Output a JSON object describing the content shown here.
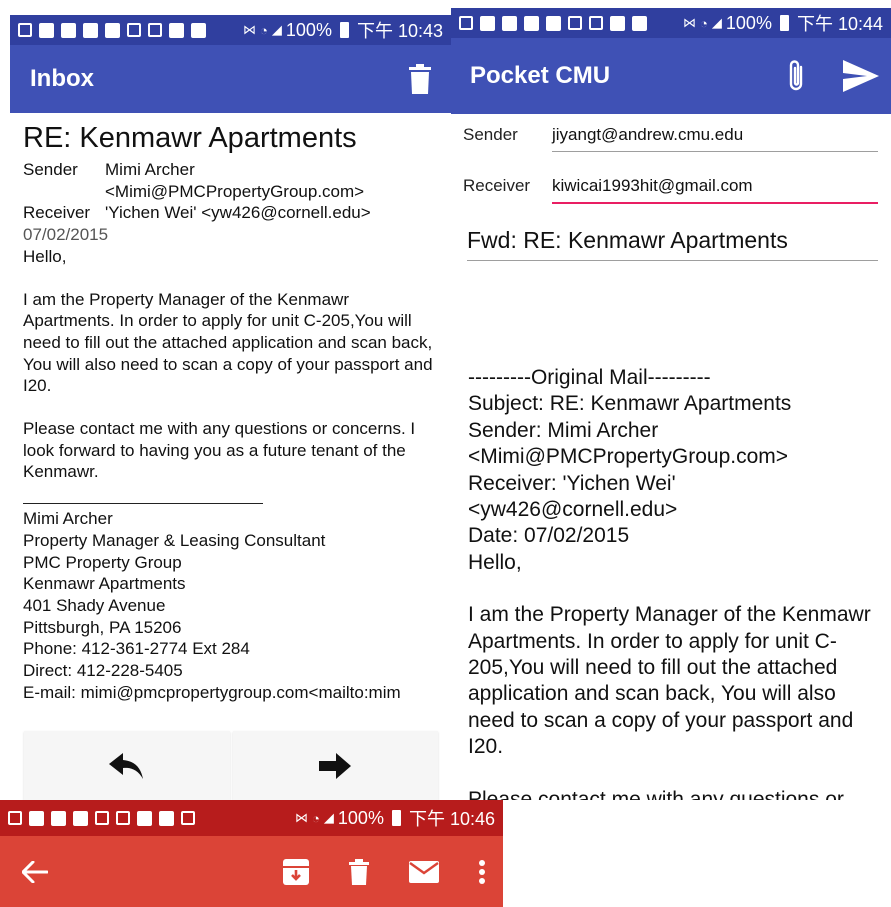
{
  "colors": {
    "primary": "#3f51b5",
    "primary_dark": "#303f9f",
    "gmail_red": "#db4437",
    "gmail_red_dark": "#b71c1c",
    "focus_underline": "#e91e63"
  },
  "panel1": {
    "status": {
      "battery": "100%",
      "time": "下午 10:43"
    },
    "appbar": {
      "title": "Inbox",
      "delete_icon": "trash-icon"
    },
    "email": {
      "subject": "RE: Kenmawr Apartments",
      "sender_label": "Sender",
      "sender_name": "Mimi Archer",
      "sender_email": "<Mimi@PMCPropertyGroup.com>",
      "receiver_label": "Receiver",
      "receiver": "'Yichen Wei' <yw426@cornell.edu>",
      "date": "07/02/2015",
      "greeting": "Hello,",
      "para1": "I am the Property Manager of the Kenmawr Apartments.  In order to apply for unit C-205,You will need to fill out the attached application and scan back, You will also need to scan a copy of your passport and I20.",
      "para2": "Please contact me with any questions or concerns. I look forward to having you as a future tenant of the Kenmawr.",
      "signature": [
        "Mimi Archer",
        "Property Manager & Leasing Consultant",
        "PMC Property Group",
        "Kenmawr Apartments",
        "401 Shady Avenue",
        "Pittsburgh, PA 15206",
        "Phone: 412-361-2774 Ext 284",
        "Direct: 412-228-5405",
        "E-mail: mimi@pmcpropertygroup.com<mailto:mim"
      ]
    },
    "nav": {
      "reply_icon": "reply-icon",
      "forward_icon": "forward-arrow-icon"
    }
  },
  "panel2": {
    "status": {
      "battery": "100%",
      "time": "下午 10:44"
    },
    "appbar": {
      "title": "Pocket CMU",
      "attach_icon": "paperclip-icon",
      "send_icon": "send-icon"
    },
    "compose": {
      "sender_label": "Sender",
      "sender_value": "jiyangt@andrew.cmu.edu",
      "receiver_label": "Receiver",
      "receiver_value": "kiwicai1993hit@gmail.com",
      "subject": "Fwd: RE: Kenmawr Apartments",
      "body_lines": [
        "---------Original Mail---------",
        "Subject: RE: Kenmawr Apartments",
        "Sender: Mimi Archer",
        "<Mimi@PMCPropertyGroup.com>",
        "Receiver: 'Yichen Wei'",
        "<yw426@cornell.edu>",
        "Date: 07/02/2015",
        "Hello,"
      ],
      "body_para": "I am the Property Manager of the Kenmawr Apartments.  In order to apply for unit C-205,You will need to fill out the attached application and scan back, You will also need to scan a copy of your passport and I20.",
      "body_tail": "Please contact me with any questions or"
    }
  },
  "panel3": {
    "status": {
      "battery": "100%",
      "time": "下午 10:46"
    },
    "appbar": {
      "back_icon": "back-arrow-icon",
      "archive_icon": "archive-icon",
      "delete_icon": "trash-icon",
      "mail_icon": "mail-icon",
      "more_icon": "more-vert-icon"
    }
  }
}
